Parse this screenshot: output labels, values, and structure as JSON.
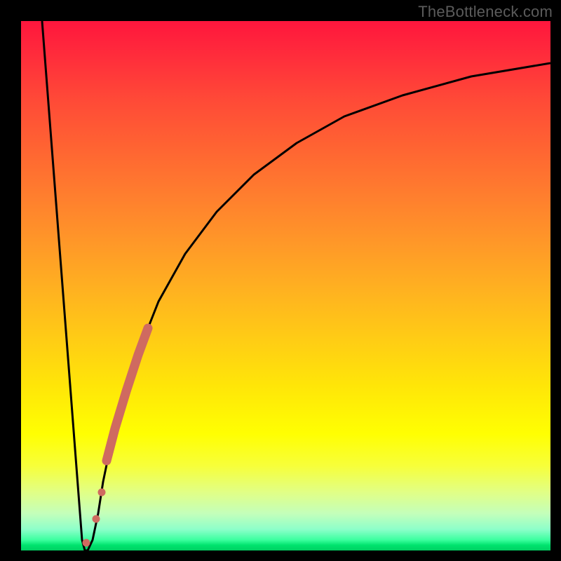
{
  "watermark": "TheBottleneck.com",
  "chart_data": {
    "type": "line",
    "title": "",
    "xlabel": "",
    "ylabel": "",
    "xlim": [
      0,
      100
    ],
    "ylim": [
      0,
      100
    ],
    "grid": false,
    "legend": null,
    "series": [
      {
        "name": "curve",
        "x": [
          4,
          11.5,
          12,
          12.5,
          13.5,
          14.5,
          15.5,
          17,
          19,
          22,
          26,
          31,
          37,
          44,
          52,
          61,
          72,
          85,
          100
        ],
        "y": [
          100,
          2,
          0,
          0,
          2,
          7,
          13,
          20,
          28,
          37,
          47,
          56,
          64,
          71,
          77,
          82,
          86,
          89.5,
          92
        ]
      },
      {
        "name": "dot-markers",
        "type": "scatter",
        "color": "#cf6a60",
        "points": [
          {
            "x": 12.3,
            "y": 1.5,
            "r": 5
          },
          {
            "x": 14.2,
            "y": 6,
            "r": 5
          },
          {
            "x": 15.2,
            "y": 11,
            "r": 5
          }
        ]
      },
      {
        "name": "thick-segment",
        "type": "line",
        "color": "#cf6a60",
        "stroke_width": 12,
        "x": [
          16.2,
          24.0
        ],
        "y": [
          17,
          42
        ]
      }
    ],
    "background_gradient": {
      "direction": "top-to-bottom",
      "stops": [
        {
          "pos": 0.0,
          "color": "#ff163d"
        },
        {
          "pos": 0.78,
          "color": "#ffff02"
        },
        {
          "pos": 1.0,
          "color": "#00d062"
        }
      ]
    }
  }
}
